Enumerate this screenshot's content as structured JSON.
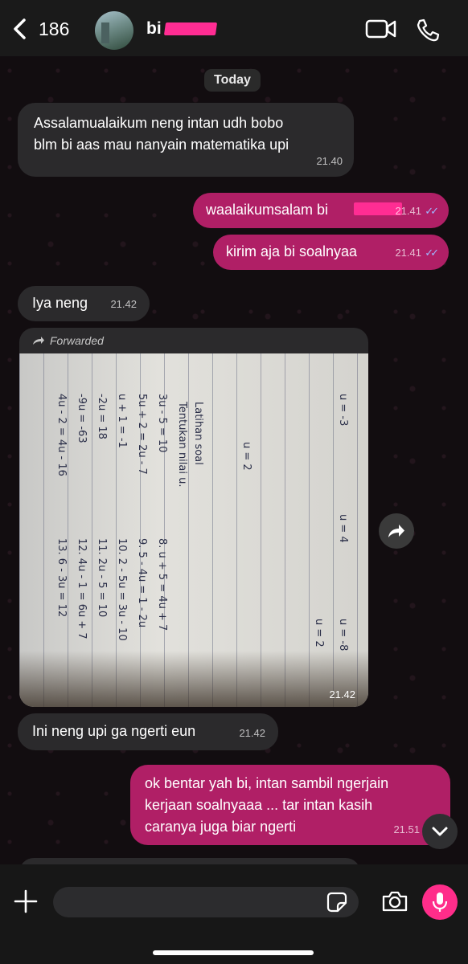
{
  "header": {
    "back_count": "186",
    "contact_name": "bi",
    "icons": [
      "chevron-left-icon",
      "video-call-icon",
      "phone-icon"
    ]
  },
  "date_label": "Today",
  "messages": [
    {
      "direction": "in",
      "text_line1": "Assalamualaikum neng intan udh bobo",
      "text_line2": "blm   bi aas mau nanyain  matematika upi",
      "time": "21.40"
    },
    {
      "direction": "out",
      "text": "waalaikumsalam bi",
      "time": "21.41",
      "status": "read"
    },
    {
      "direction": "out",
      "text": "kirim aja bi soalnyaa",
      "time": "21.41",
      "status": "read"
    },
    {
      "direction": "in",
      "text": "Iya neng",
      "time": "21.42"
    },
    {
      "direction": "in",
      "type": "photo",
      "forwarded_label": "Forwarded",
      "time": "21.42",
      "handwriting": [
        "Latihan soal",
        "Tentukan nilai u.",
        "3u - 5 = 10",
        "5u + 2 = 2u - 7",
        "u + 1 = -1",
        "-2u = 18",
        "-9u = -63",
        "4u - 2 = 4u - 16",
        "8. u + 5 = 4u + 7",
        "9. 5 - 4u = 1 - 2u",
        "10. 2 - 5u = 3u - 10",
        "11. 2u - 5 = 10",
        "12. 4u - 1 = 6u + 7",
        "13. 6 - 3u = 12",
        "u = 2",
        "u = -3",
        "u = 4",
        "u = -8",
        "u = 2"
      ]
    },
    {
      "direction": "in",
      "text": "Ini neng upi ga ngerti eun",
      "time": "21.42"
    },
    {
      "direction": "out",
      "text_line1": "ok bentar yah bi, intan sambil ngerjain",
      "text_line2": "kerjaan soalnyaaa ... tar intan kasih",
      "text_line3": "caranya juga biar ngerti",
      "time": "21.51"
    }
  ],
  "composer": {
    "placeholder": "",
    "icons": [
      "plus-icon",
      "sticker-icon",
      "camera-icon",
      "microphone-icon"
    ]
  },
  "colors": {
    "outgoing_bubble": "#b01f66",
    "incoming_bubble": "#2b2a2c",
    "accent": "#ff2d8a",
    "read_ticks": "#9fb7ff"
  }
}
